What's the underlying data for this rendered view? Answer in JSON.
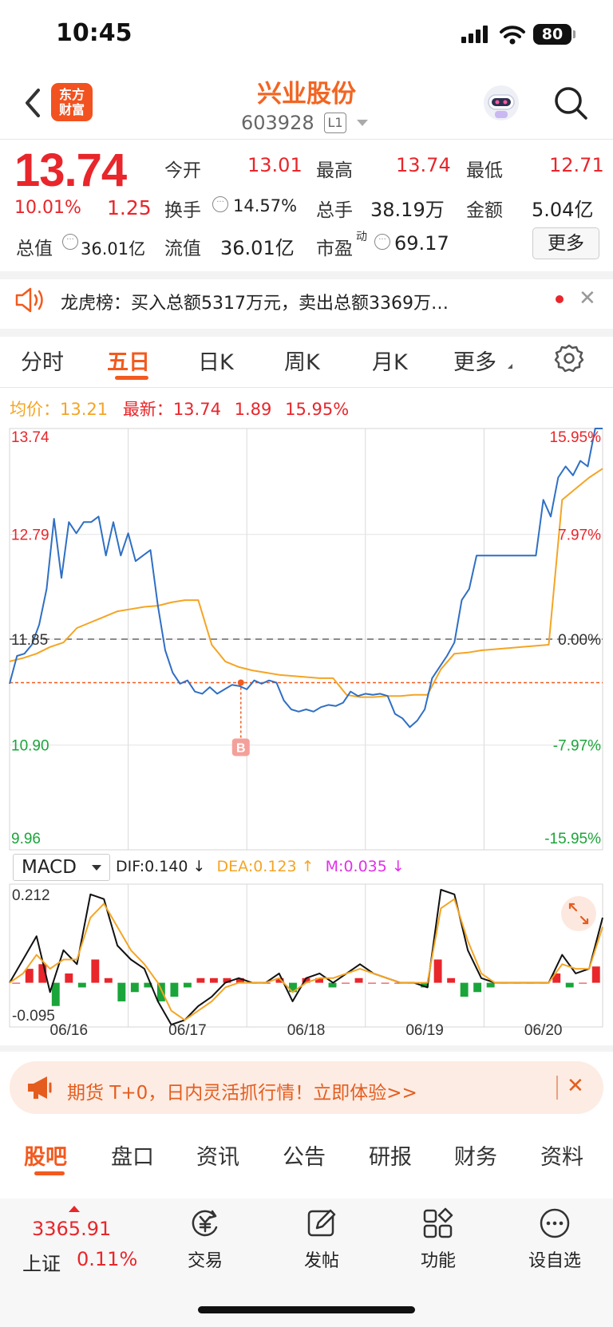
{
  "status_bar": {
    "time": "10:45",
    "battery": "80"
  },
  "header": {
    "logo": [
      "东方",
      "财富"
    ],
    "stock_name": "兴业股份",
    "stock_code": "603928",
    "level": "L1"
  },
  "quote": {
    "price": "13.74",
    "change_pct": "10.01%",
    "change": "1.25",
    "open_label": "今开",
    "open": "13.01",
    "high_label": "最高",
    "high": "13.74",
    "low_label": "最低",
    "low": "12.71",
    "turnover_label": "换手",
    "turnover": "14.57%",
    "volume_label": "总手",
    "volume": "38.19万",
    "amount_label": "金额",
    "amount": "5.04亿",
    "mktcap_label": "总值",
    "mktcap": "36.01亿",
    "float_label": "流值",
    "float_cap": "36.01亿",
    "pe_label": "市盈",
    "pe_sup": "动",
    "pe": "69.17",
    "more_label": "更多"
  },
  "dragon_tiger": {
    "text": "龙虎榜：买入总额5317万元，卖出总额3369万…"
  },
  "period_tabs": [
    "分时",
    "五日",
    "日K",
    "周K",
    "月K",
    "更多"
  ],
  "active_period": "五日",
  "summary": {
    "avg_label": "均价：",
    "avg": "13.21",
    "latest_label": "最新：",
    "latest": "13.74",
    "change": "1.89",
    "change_pct": "15.95%"
  },
  "chart_data": [
    {
      "type": "line",
      "title": "",
      "days": [
        "06/16",
        "06/17",
        "06/18",
        "06/19",
        "06/20"
      ],
      "y_labels_left": [
        "13.74",
        "12.79",
        "11.85",
        "10.90",
        "9.96"
      ],
      "y_labels_right": [
        "15.95%",
        "7.97%",
        "0.00%",
        "-7.97%",
        "-15.95%"
      ],
      "ylim": [
        9.96,
        13.74
      ],
      "prev_close": 11.85,
      "reference_line": 11.46,
      "marker": {
        "label": "B",
        "day": "06/17",
        "price": 11.46
      },
      "series": [
        {
          "name": "",
          "color": "#2f6fc4",
          "values": [
            11.45,
            11.7,
            11.72,
            11.8,
            11.98,
            12.3,
            12.93,
            12.4,
            12.9,
            12.8,
            12.9,
            12.9,
            12.95,
            12.6,
            12.9,
            12.6,
            12.8,
            12.55,
            12.6,
            12.65,
            12.15,
            11.75,
            11.55,
            11.45,
            11.48,
            11.38,
            11.36,
            11.42,
            11.36,
            11.4,
            11.44,
            11.43,
            11.4,
            11.48,
            11.45,
            11.48,
            11.46,
            11.3,
            11.22,
            11.2,
            11.22,
            11.2,
            11.24,
            11.26,
            11.25,
            11.28,
            11.38,
            11.34,
            11.36,
            11.35,
            11.36,
            11.34,
            11.18,
            11.14,
            11.06,
            11.12,
            11.22,
            11.5,
            11.6,
            11.7,
            11.82,
            12.2,
            12.3,
            12.6,
            12.6,
            12.6,
            12.6,
            12.6,
            12.6,
            12.6,
            12.6,
            12.6,
            13.1,
            12.95,
            13.3,
            13.4,
            13.32,
            13.45,
            13.4,
            13.74,
            13.74
          ]
        },
        {
          "name": "",
          "color": "#f4a524",
          "values": [
            11.65,
            11.68,
            11.72,
            11.78,
            11.82,
            11.95,
            12.0,
            12.05,
            12.1,
            12.12,
            12.14,
            12.15,
            12.18,
            12.2,
            12.2,
            11.8,
            11.65,
            11.6,
            11.57,
            11.55,
            11.53,
            11.52,
            11.51,
            11.5,
            11.5,
            11.35,
            11.33,
            11.33,
            11.34,
            11.34,
            11.35,
            11.35,
            11.58,
            11.72,
            11.73,
            11.75,
            11.76,
            11.77,
            11.78,
            11.79,
            11.8,
            13.1,
            13.2,
            13.3,
            13.38
          ]
        }
      ]
    },
    {
      "type": "bar",
      "title": "MACD",
      "ylim": [
        -0.095,
        0.212
      ],
      "y_labels": [
        "0.212",
        "-0.095"
      ],
      "dif": "0.140",
      "dea": "0.123",
      "m": "0.035",
      "series": [
        {
          "name": "DIF",
          "values": [
            0.0,
            0.05,
            0.1,
            -0.02,
            0.07,
            0.04,
            0.19,
            0.18,
            0.08,
            0.05,
            0.03,
            -0.04,
            -0.09,
            -0.08,
            -0.05,
            -0.03,
            0.0,
            0.01,
            0.0,
            0.0,
            0.02,
            -0.04,
            0.01,
            0.02,
            0.0,
            0.02,
            0.04,
            0.02,
            0.01,
            0.0,
            0.0,
            -0.01,
            0.2,
            0.19,
            0.07,
            0.01,
            0.0,
            0.0,
            0.0,
            0.0,
            0.0,
            0.06,
            0.02,
            0.03,
            0.14
          ]
        },
        {
          "name": "DEA",
          "values": [
            0.0,
            0.02,
            0.06,
            0.03,
            0.05,
            0.05,
            0.14,
            0.17,
            0.12,
            0.07,
            0.04,
            0.0,
            -0.06,
            -0.08,
            -0.06,
            -0.04,
            -0.01,
            0.0,
            0.0,
            0.0,
            0.01,
            -0.02,
            0.0,
            0.01,
            0.01,
            0.02,
            0.03,
            0.02,
            0.01,
            0.0,
            0.0,
            0.0,
            0.16,
            0.18,
            0.09,
            0.02,
            0.0,
            0.0,
            0.0,
            0.0,
            0.0,
            0.04,
            0.03,
            0.03,
            0.12
          ]
        },
        {
          "name": "M",
          "values": [
            0.0,
            0.03,
            0.04,
            -0.05,
            0.02,
            -0.01,
            0.05,
            0.01,
            -0.04,
            -0.02,
            -0.01,
            -0.04,
            -0.03,
            -0.01,
            0.01,
            0.01,
            0.01,
            0.01,
            0.0,
            0.0,
            0.01,
            -0.02,
            0.01,
            0.01,
            -0.01,
            0.0,
            0.01,
            0.0,
            0.0,
            0.0,
            0.0,
            -0.01,
            0.05,
            0.01,
            -0.03,
            -0.02,
            -0.01,
            0.0,
            0.0,
            0.0,
            0.0,
            0.02,
            -0.01,
            0.0,
            0.035
          ]
        }
      ]
    }
  ],
  "macd_panel": {
    "indicator": "MACD",
    "dif_label": "DIF:",
    "dif": "0.140",
    "dif_arrow": "↓",
    "dea_label": "DEA:",
    "dea": "0.123",
    "dea_arrow": "↑",
    "m_label": "M:",
    "m": "0.035",
    "m_arrow": "↓"
  },
  "banner": {
    "text": "期货 T+0，日内灵活抓行情！立即体验>>"
  },
  "content_tabs": [
    "股吧",
    "盘口",
    "资讯",
    "公告",
    "研报",
    "财务",
    "资料"
  ],
  "active_content_tab": "股吧",
  "bottom_nav": {
    "index_value": "3365.91",
    "index_name": "上证",
    "index_pct": "0.11%",
    "items": [
      {
        "label": "交易",
        "icon": "yen-exchange-icon"
      },
      {
        "label": "发帖",
        "icon": "compose-icon"
      },
      {
        "label": "功能",
        "icon": "grid-apps-icon"
      },
      {
        "label": "设自选",
        "icon": "more-circle-icon"
      }
    ]
  },
  "colors": {
    "up": "#e8262b",
    "down": "#1aa53a",
    "accent": "#f25a1e",
    "price_line": "#2f6fc4",
    "avg_line": "#f4a524"
  }
}
